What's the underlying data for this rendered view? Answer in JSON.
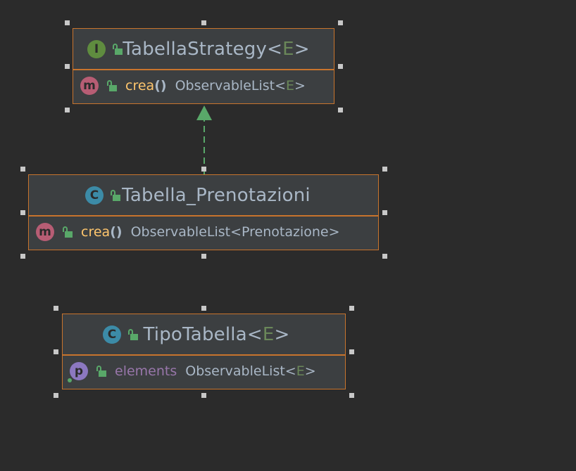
{
  "diagram": {
    "nodes": [
      {
        "id": "tabella-strategy",
        "kind": "interface",
        "kind_badge": "I",
        "name": "TabellaStrategy",
        "generic": "E",
        "members": [
          {
            "badge": "m",
            "name": "crea",
            "parens": "()",
            "type_base": "ObservableList",
            "type_generic": "E"
          }
        ]
      },
      {
        "id": "tabella-prenotazioni",
        "kind": "class",
        "kind_badge": "C",
        "name": "Tabella_Prenotazioni",
        "members": [
          {
            "badge": "m",
            "name": "crea",
            "parens": "()",
            "type": "ObservableList<Prenotazione>"
          }
        ]
      },
      {
        "id": "tipo-tabella",
        "kind": "class",
        "kind_badge": "C",
        "name": "TipoTabella",
        "generic": "E",
        "members": [
          {
            "badge": "p",
            "name": "elements",
            "type_base": "ObservableList",
            "type_generic": "E"
          }
        ]
      }
    ],
    "edges": [
      {
        "from": "tabella-prenotazioni",
        "to": "tabella-strategy",
        "type": "implements",
        "style": "dashed",
        "color": "#59a869"
      }
    ]
  },
  "colors": {
    "background": "#2b2b2b",
    "node_border": "#c8742d",
    "node_fill": "#3c3f41",
    "text": "#a9b7c6",
    "generic": "#6a8759",
    "method": "#ffc66d",
    "field": "#9876aa"
  }
}
